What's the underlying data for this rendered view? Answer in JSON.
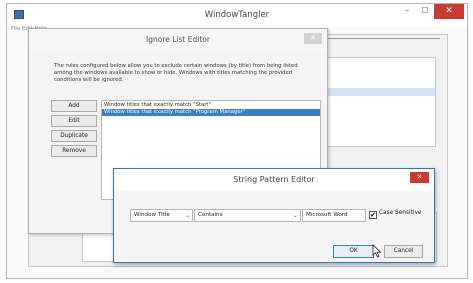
{
  "main": {
    "title": "WindowTangler",
    "menu": "File  Edit  Help",
    "window_buttons": {
      "minimize": "–",
      "maximize": "☐",
      "close": "✕"
    }
  },
  "ignore_dialog": {
    "title": "Ignore List Editor",
    "close": "✕",
    "description": "The rules configured below allow you to exclude certain windows (by title) from being listed among the windows available to show or hide.  Windows with titles matching the provided conditions will be ignored.",
    "buttons": {
      "add": "Add",
      "edit": "Edit",
      "duplicate": "Duplicate",
      "remove": "Remove"
    },
    "rules": [
      "Window titles that exactly match \"Start\"",
      "Window titles that exactly match \"Program Manager\""
    ]
  },
  "pattern_dialog": {
    "title": "String Pattern Editor",
    "close": "✕",
    "field_value": "Window Title",
    "match_value": "Contains",
    "pattern_value": "Microsoft Word",
    "case_sensitive_label": "Case Sensitive",
    "case_sensitive_checked": "✔",
    "ok_label": "OK",
    "cancel_label": "Cancel"
  },
  "icons": {
    "dropdown": "⌄"
  },
  "colors": {
    "accent": "#2b77c0",
    "selection": "#3a7ec6",
    "close_red": "#c93a31"
  }
}
